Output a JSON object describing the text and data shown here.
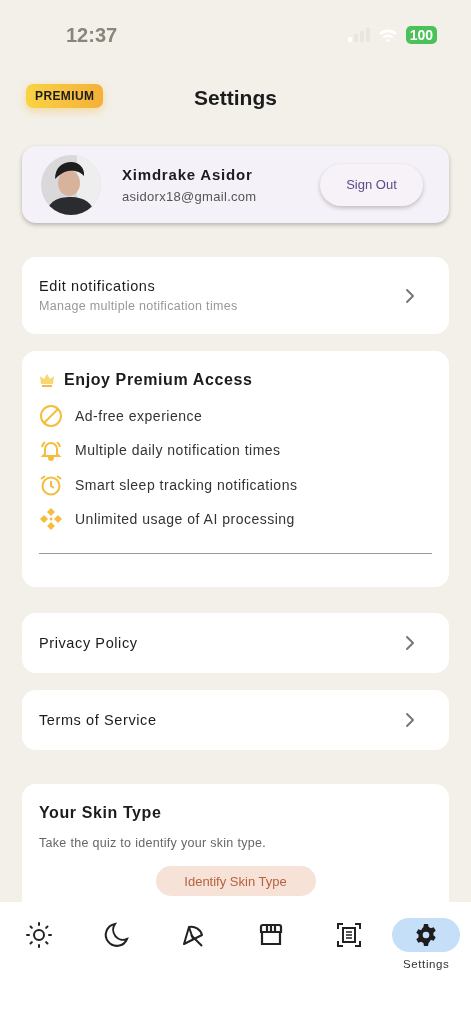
{
  "status_bar": {
    "time": "12:37",
    "battery": "100"
  },
  "header": {
    "badge": "PREMIUM",
    "title": "Settings"
  },
  "profile": {
    "name": "Ximdrake Asidor",
    "email": "asidorx18@gmail.com",
    "button": "Sign Out"
  },
  "notifications": {
    "title": "Edit notifications",
    "subtitle": "Manage multiple notification times"
  },
  "premium": {
    "title": "Enjoy Premium Access",
    "features": [
      {
        "text": "Ad-free experience"
      },
      {
        "text": "Multiple daily notification times"
      },
      {
        "text": "Smart sleep tracking notifications"
      },
      {
        "text": "Unlimited usage of AI processing"
      }
    ]
  },
  "links": [
    {
      "title": "Privacy Policy"
    },
    {
      "title": "Terms of Service"
    }
  ],
  "skin_type": {
    "title": "Your Skin Type",
    "description": "Take the quiz to identify your skin type.",
    "button": "Identify Skin Type"
  },
  "nav": [
    {
      "selected": false
    },
    {
      "selected": false
    },
    {
      "selected": false
    },
    {
      "selected": false
    },
    {
      "selected": false
    },
    {
      "label": "Settings",
      "selected": true
    }
  ]
}
